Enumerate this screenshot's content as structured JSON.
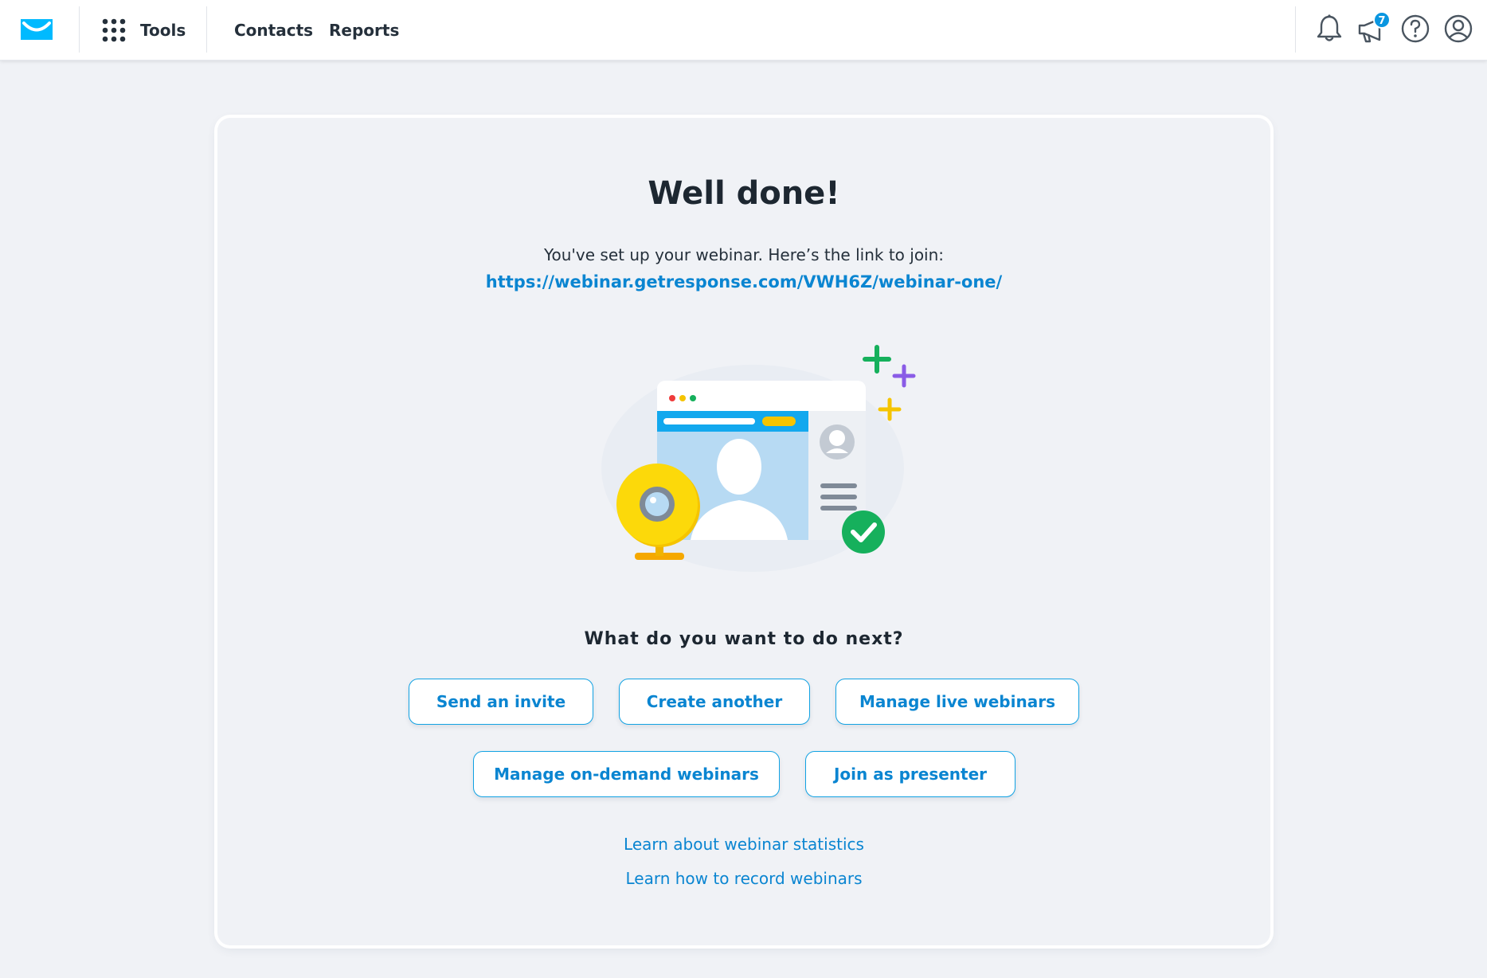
{
  "topbar": {
    "tools_label": "Tools",
    "nav": [
      {
        "label": "Contacts"
      },
      {
        "label": "Reports"
      }
    ],
    "announcements_badge": "7",
    "icons": [
      "envelope-logo-icon",
      "grid-icon",
      "bell-icon",
      "megaphone-icon",
      "help-icon",
      "account-icon"
    ]
  },
  "main": {
    "title": "Well done!",
    "subtitle": "You've set up your webinar. Here’s the link to join:",
    "link": "https://webinar.getresponse.com/VWH6Z/webinar-one/",
    "question": "What do you want to do next?",
    "actions": [
      {
        "label": "Send an invite"
      },
      {
        "label": "Create another"
      },
      {
        "label": "Manage live webinars"
      },
      {
        "label": "Manage on-demand webinars"
      },
      {
        "label": "Join as presenter"
      }
    ],
    "learn_links": [
      {
        "label": "Learn about webinar statistics"
      },
      {
        "label": "Learn how to record webinars"
      }
    ]
  },
  "colors": {
    "accent": "#0a85d1",
    "brand": "#00baff",
    "background": "#f0f2f6"
  }
}
